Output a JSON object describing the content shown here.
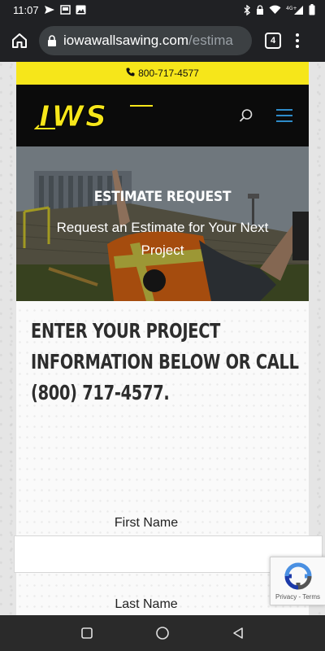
{
  "status_bar": {
    "time": "11:07",
    "network": "4G+"
  },
  "browser": {
    "url_host": "iowawallsawing.com",
    "url_path": "/estima",
    "tab_count": "4"
  },
  "site": {
    "phone_strip": "800-717-4577",
    "logo_text": "IWS",
    "colors": {
      "brand_yellow": "#f6e61a",
      "menu_blue": "#2e8bc9",
      "header_black": "#0b0b0b"
    },
    "hero": {
      "title": "ESTIMATE REQUEST",
      "subtitle": "Request an Estimate for Your Next Project"
    },
    "intro_heading": "ENTER YOUR PROJECT INFORMATION BELOW OR CALL (800) 717-4577.",
    "form": {
      "first_name_label": "First Name",
      "last_name_label": "Last Name"
    },
    "recaptcha_links": "Privacy - Terms"
  },
  "icons": {
    "status": [
      "send-icon",
      "photo-icon",
      "image-icon",
      "bluetooth-icon",
      "lock-icon",
      "wifi-icon",
      "signal-icon",
      "battery-icon"
    ],
    "browser": [
      "home-icon",
      "lock-icon",
      "tab-switcher-icon",
      "menu-dots-icon"
    ],
    "site": [
      "phone-icon",
      "search-icon",
      "hamburger-menu-icon",
      "recaptcha-icon"
    ],
    "nav": [
      "recents-icon",
      "home-circle-icon",
      "back-icon"
    ]
  }
}
